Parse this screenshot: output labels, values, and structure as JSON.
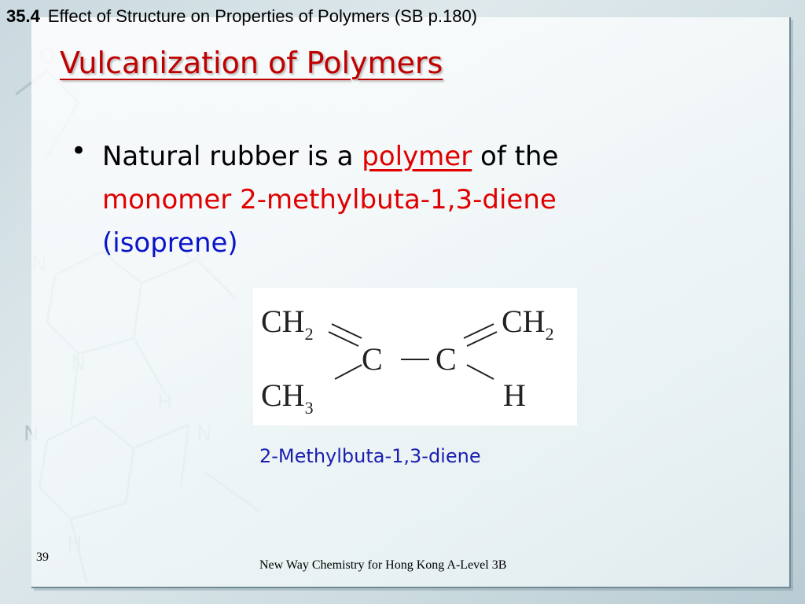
{
  "header": {
    "section_number": "35.4",
    "section_title": "Effect of Structure on Properties of Polymers (SB p.180)"
  },
  "title": "Vulcanization of Polymers",
  "bullet": {
    "marker": "•",
    "part1": "Natural rubber is a ",
    "polymer": "polymer",
    "part2": " of the",
    "monomer": "monomer 2-methylbuta-1,3-diene",
    "isoprene": "(isoprene)"
  },
  "structure": {
    "top_left": "CH",
    "top_left_sub": "2",
    "bottom_left": "CH",
    "bottom_left_sub": "3",
    "center_left": "C",
    "center_right": "C",
    "top_right": "CH",
    "top_right_sub": "2",
    "bottom_right": "H"
  },
  "caption": "2-Methylbuta-1,3-diene",
  "page_number": "39",
  "footer": "New Way Chemistry for Hong Kong A-Level 3B",
  "colors": {
    "title_red": "#c00000",
    "highlight_red": "#e00000",
    "blue": "#0a14c8",
    "caption_blue": "#1a1fb0"
  }
}
